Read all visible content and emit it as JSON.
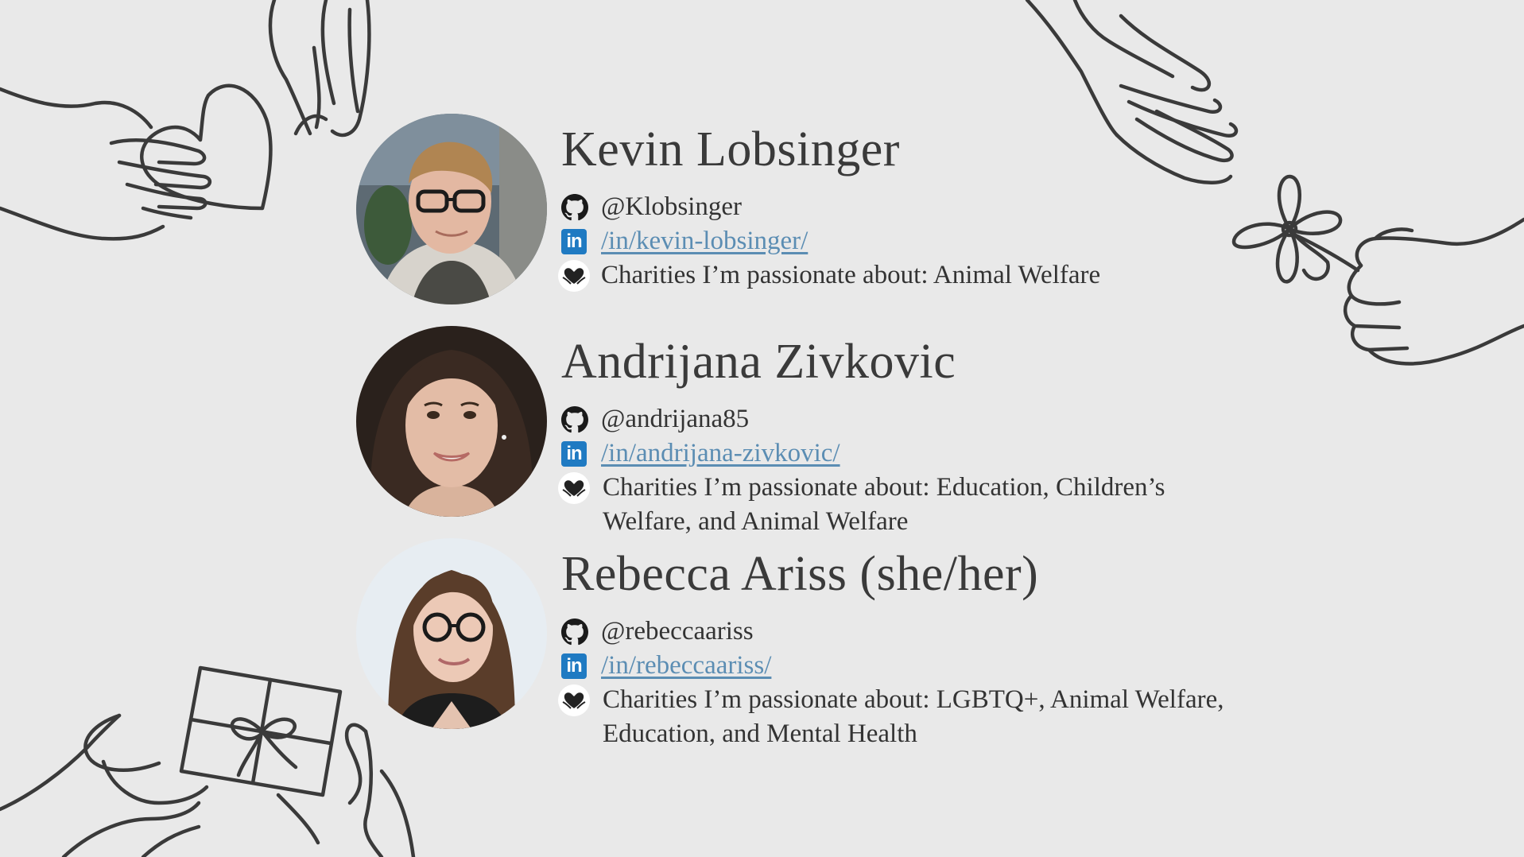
{
  "people": [
    {
      "name": "Kevin Lobsinger",
      "github": "@Klobsinger",
      "linkedin": "/in/kevin-lobsinger/",
      "charities": "Charities I’m passionate about: Animal Welfare"
    },
    {
      "name": "Andrijana Zivkovic",
      "github": "@andrijana85",
      "linkedin": "/in/andrijana-zivkovic/",
      "charities": "Charities I’m passionate about: Education, Children’s Welfare, and Animal Welfare"
    },
    {
      "name": "Rebecca Ariss (she/her)",
      "github": "@rebeccaariss",
      "linkedin": "/in/rebeccaariss/",
      "charities": "Charities I’m passionate about: LGBTQ+, Animal Welfare, Education, and Mental Health"
    }
  ],
  "icons": {
    "github": "github-icon",
    "linkedin": "linkedin-icon",
    "charity": "heart-hands-icon",
    "linkedin_glyph": "in"
  },
  "colors": {
    "background": "#e9e9e9",
    "text": "#333333",
    "link": "#5b8db3",
    "linkedin": "#1f7ac2",
    "sketch": "#3a3a3a"
  }
}
